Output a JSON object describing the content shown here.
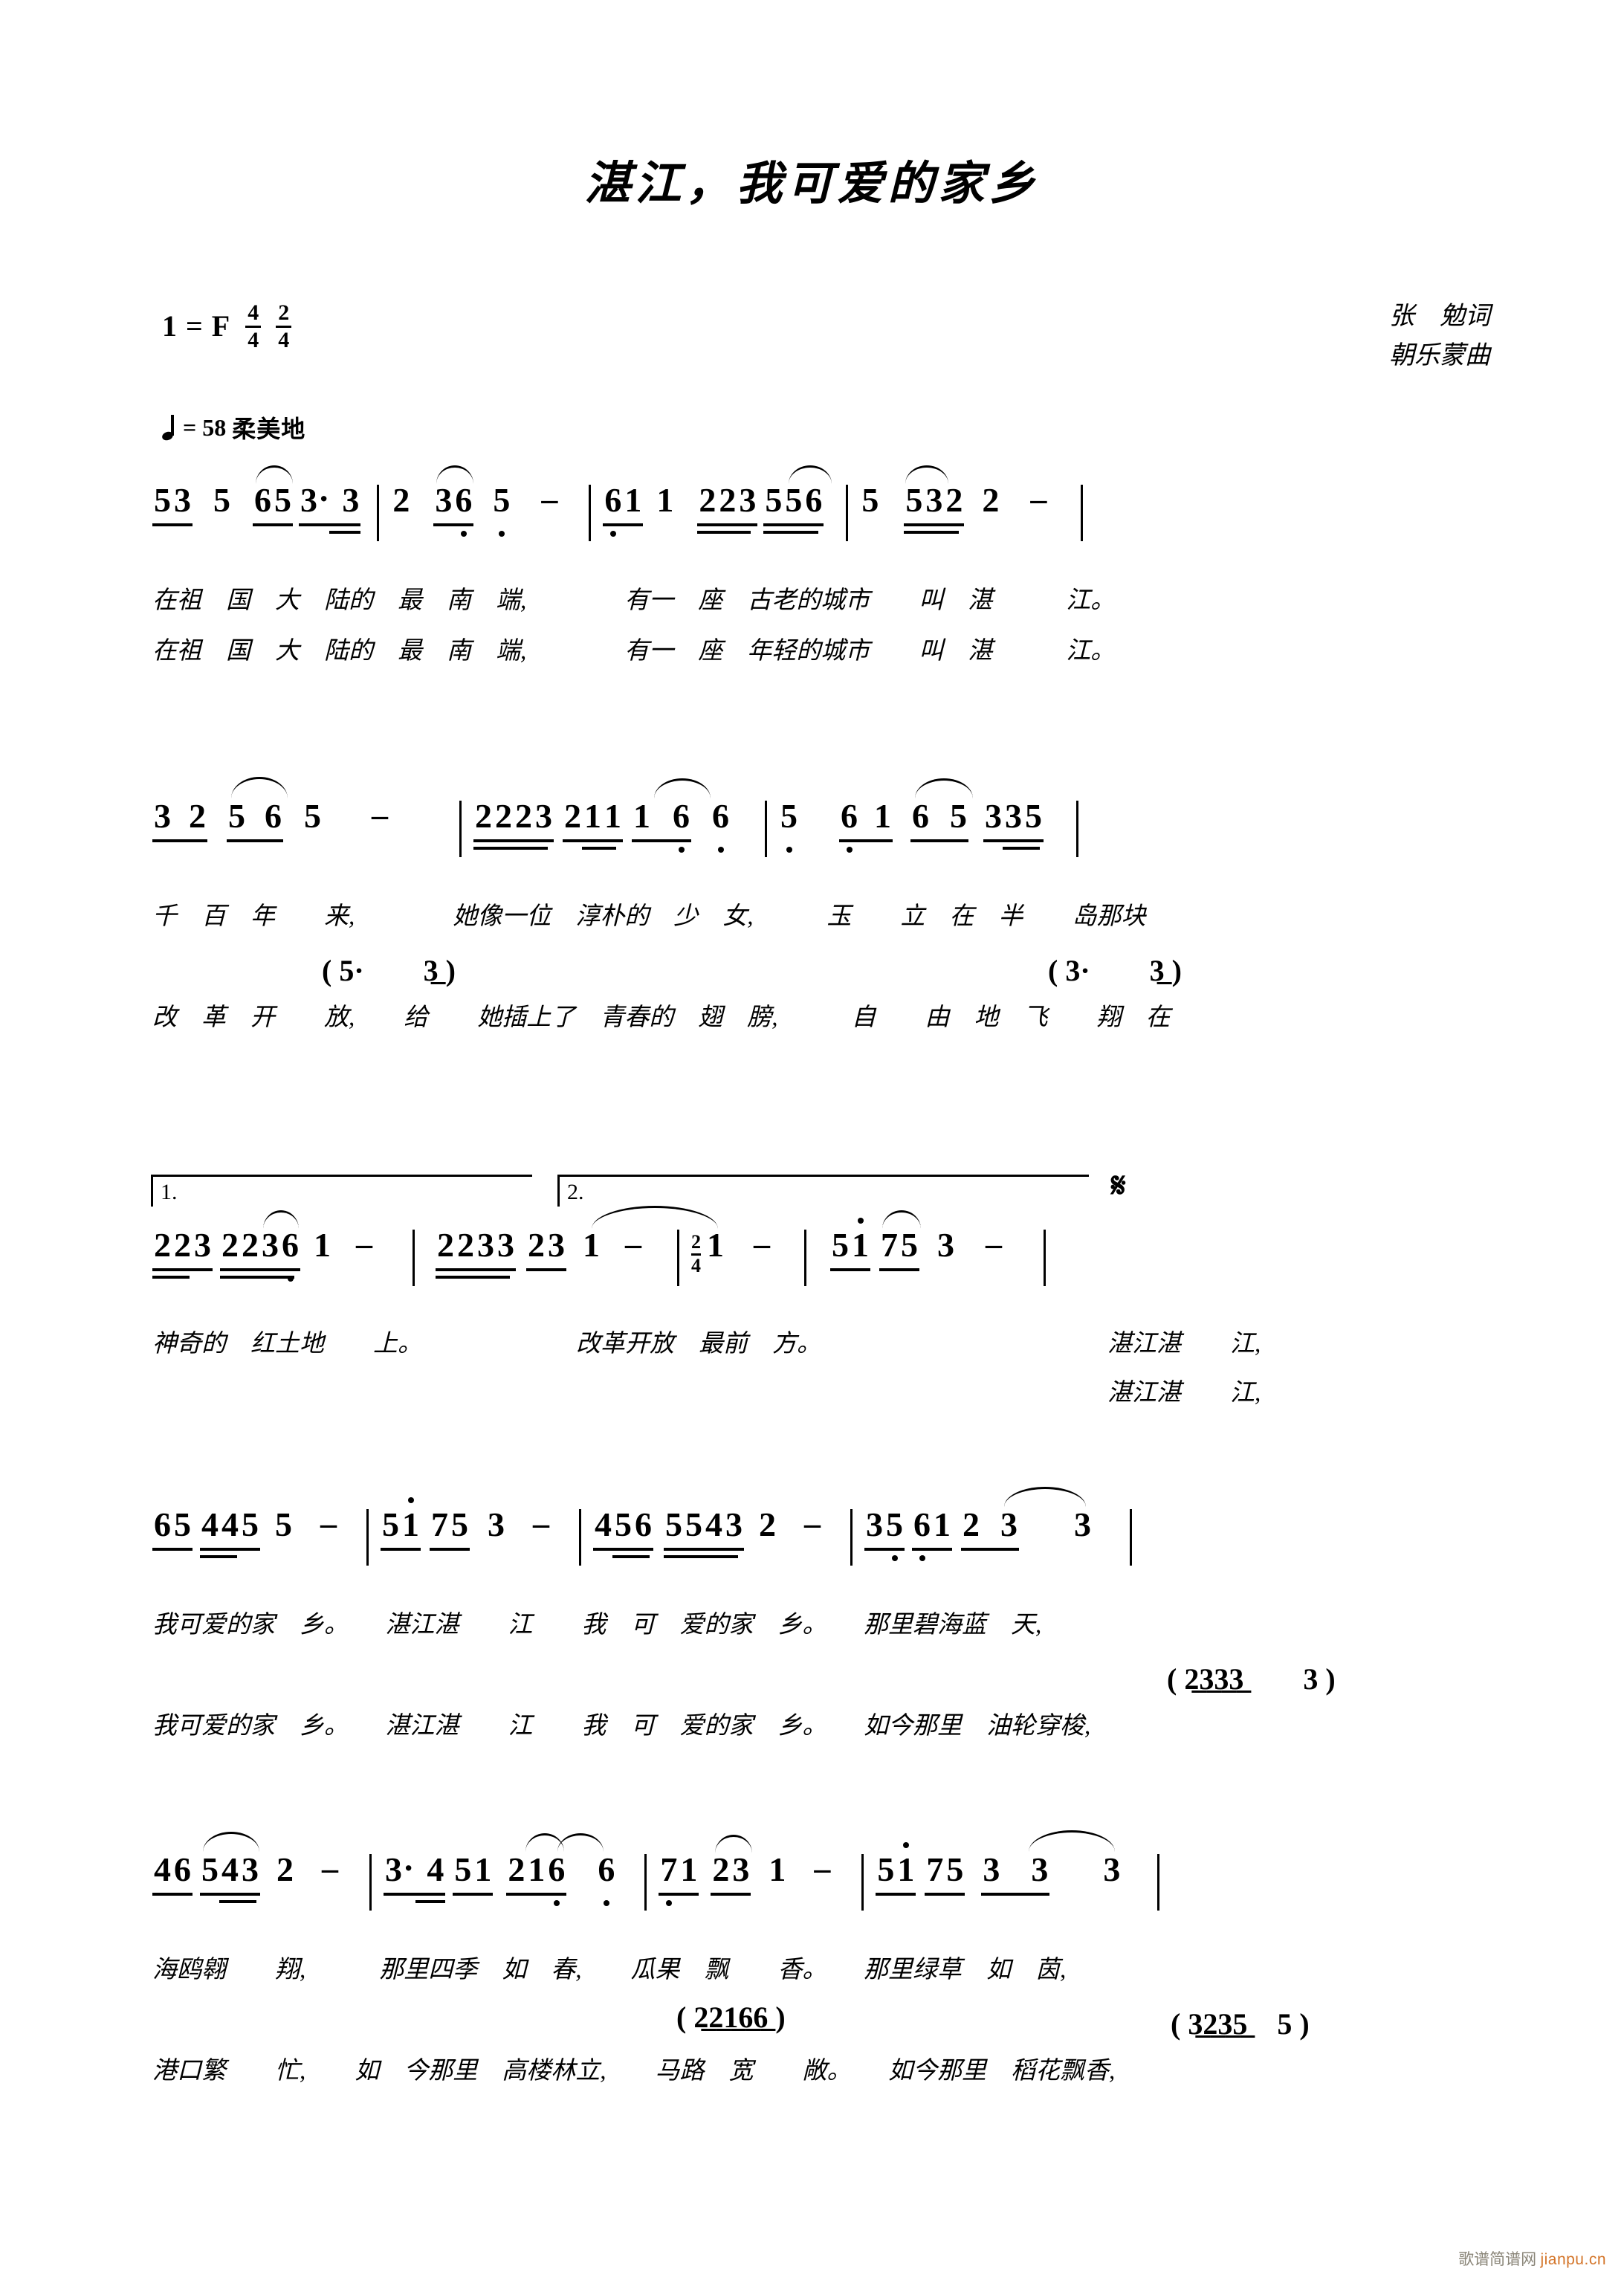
{
  "title": "湛江，我可爱的家乡",
  "header": {
    "key_label": "1 = F",
    "time_signatures": [
      {
        "num": "4",
        "den": "4"
      },
      {
        "num": "2",
        "den": "4"
      }
    ],
    "tempo_value": "= 58",
    "tempo_mark": "柔美地",
    "lyricist": "张　勉词",
    "composer": "朝乐蒙曲"
  },
  "watermark": {
    "cn": "歌谱简谱网",
    "en": "jianpu.cn"
  },
  "systems": [
    {
      "id": "system-1",
      "measures": [
        {
          "notes": "5̲3̲ 5 6̲5̲ 3̲·3̲̲"
        },
        {
          "notes": "2 3̲6̲ 5 -"
        },
        {
          "notes": "6̲1̲ 1 2̲2̲3̲5̲ 5̲6̲"
        },
        {
          "notes": "5 5̲3̲2̲ 2 -"
        }
      ],
      "lyrics_1": "在祖　国　大　陆的　最　南　端,　　　　有一　座　古老的城市　　叫　湛　　　江。",
      "lyrics_2": "在祖　国　大　陆的　最　南　端,　　　　有一　座　年轻的城市　　叫　湛　　　江。"
    },
    {
      "id": "system-2",
      "measures": [
        {
          "notes": "3̲2̲ 5̲6̲ 5 -"
        },
        {
          "notes": "2̲2̲2̲3̲ 2̲1̲1̲ 1̲6̲ 6"
        },
        {
          "notes": "5 6̲1̲ 6̲5̲ 3̲3̲5̲"
        }
      ],
      "lyrics_1": "千　百　年　　来,　　　　她像一位　淳朴的　少　女,　　　玉　　立　在　半　　岛那块",
      "lyrics_2": "改　革　开　　放,　　给　　她插上了　青春的　翅　膀,　　　自　　由　地　飞　　翔　在",
      "alt_left": "( 5·　　3̲ )",
      "alt_right": "( 3·　　3̲ )"
    },
    {
      "id": "system-3",
      "volta_1": "1.",
      "volta_2": "2.",
      "measures": [
        {
          "notes": "2̲2̲3̲ 2̲2̲3̲6̲ 1 -"
        },
        {
          "notes": "2̲2̲3̲3̲ 2̲3̲ 1 -"
        },
        {
          "notes": "2/4 1 -"
        },
        {
          "notes": "5̲1̲̇ 7̲5̲ 3 -"
        }
      ],
      "segno": "𝄋",
      "lyrics_1": "神奇的　红土地　　上。",
      "lyrics_1b": "改革开放　最前　方。",
      "lyrics_r1": "湛江湛　　江,",
      "lyrics_r2": "湛江湛　　江,"
    },
    {
      "id": "system-4",
      "measures": [
        {
          "notes": "6̲5̲ 4̲4̲5̲ 5 -"
        },
        {
          "notes": "5̲1̲̇ 7̲5̲ 3 -"
        },
        {
          "notes": "4̲5̲6̲ 5̲5̲4̲3̲ 2 -"
        },
        {
          "notes": "3̲5̲ 6̲1̲ 2̲3̲ 3"
        }
      ],
      "lyrics_1": "我可爱的家　乡。　　湛江湛　　江　　我　可　爱的家　乡。　　那里碧海蓝　天,",
      "lyrics_2": "我可爱的家　乡。　　湛江湛　　江　　我　可　爱的家　乡。　　如今那里　油轮穿梭,",
      "alt_right": "( 2̲3̲3̲3̲　　3 )"
    },
    {
      "id": "system-5",
      "measures": [
        {
          "notes": "4̲6̲ 5̲4̲3̲ 2 -"
        },
        {
          "notes": "3̲·4̲̲ 5̲1̲ 2̲1̲6̲ 6"
        },
        {
          "notes": "7̲1̲ 2̲3̲ 1 -"
        },
        {
          "notes": "5̲1̲̇ 7̲5̲ 3̲ 3 3"
        }
      ],
      "lyrics_1": "海鸥翱　　翔,　　　那里四季　如　春,　　瓜果　飘　　香。　　那里绿草　如　茵,",
      "lyrics_2": "港口繁　　忙,　　如　今那里　高楼林立,　　马路　宽　　敞。　　如今那里　稻花飘香,",
      "alt_mid": "( 2̲2̲1̲6̲6̲ )",
      "alt_right": "( 3̲2̲3̲5̲　5 )"
    }
  ],
  "notation": {
    "sys1_lyrics1": [
      "在",
      "祖",
      "国",
      "大",
      "陆的",
      "最",
      "南",
      "端,",
      "有一",
      "座",
      "古老的城市",
      "叫",
      "湛",
      "江。"
    ],
    "sys1_lyrics2": [
      "在",
      "祖",
      "国",
      "大",
      "陆的",
      "最",
      "南",
      "端,",
      "有一",
      "座",
      "年轻的城市",
      "叫",
      "湛",
      "江。"
    ]
  }
}
